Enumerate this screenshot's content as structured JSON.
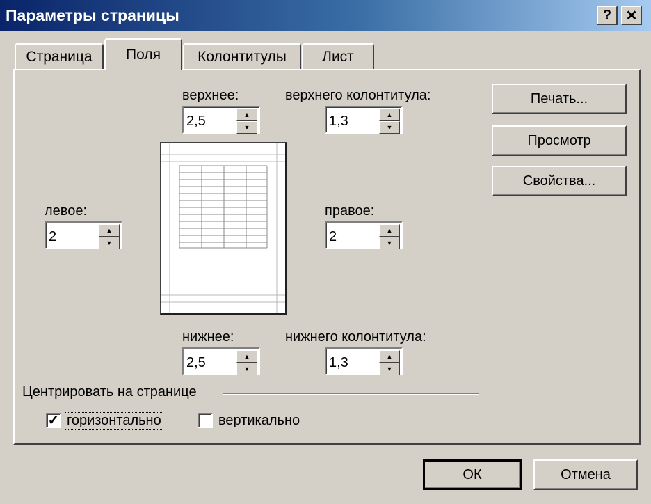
{
  "window": {
    "title": "Параметры страницы",
    "help_btn": "?",
    "close_btn": "✕"
  },
  "tabs": [
    {
      "label": "Страница",
      "active": false
    },
    {
      "label": "Поля",
      "active": true
    },
    {
      "label": "Колонтитулы",
      "active": false
    },
    {
      "label": "Лист",
      "active": false
    }
  ],
  "margins": {
    "top": {
      "label": "верхнее:",
      "value": "2,5"
    },
    "header": {
      "label": "верхнего колонтитула:",
      "value": "1,3"
    },
    "left": {
      "label": "левое:",
      "value": "2"
    },
    "right": {
      "label": "правое:",
      "value": "2"
    },
    "bottom": {
      "label": "нижнее:",
      "value": "2,5"
    },
    "footer": {
      "label": "нижнего колонтитула:",
      "value": "1,3"
    }
  },
  "side_buttons": {
    "print": "Печать...",
    "preview": "Просмотр",
    "properties": "Свойства..."
  },
  "center": {
    "group_label": "Центрировать на странице",
    "horizontal": {
      "label": "горизонтально",
      "checked": true
    },
    "vertical": {
      "label": "вертикально",
      "checked": false
    }
  },
  "footer_buttons": {
    "ok": "ОК",
    "cancel": "Отмена"
  }
}
